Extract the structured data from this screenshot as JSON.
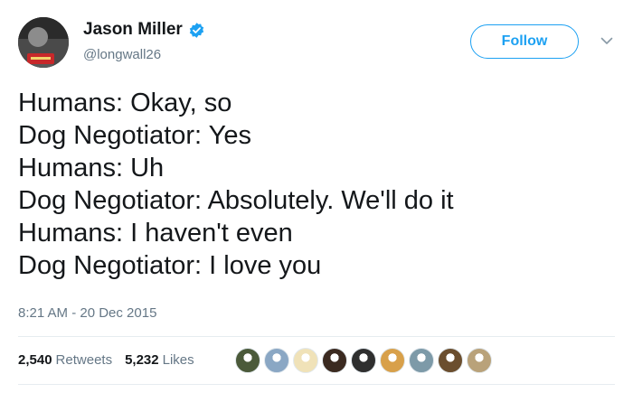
{
  "user": {
    "name": "Jason Miller",
    "handle": "@longwall26"
  },
  "follow_label": "Follow",
  "tweet_lines": [
    "Humans: Okay, so",
    "Dog Negotiator: Yes",
    "Humans: Uh",
    "Dog Negotiator: Absolutely. We'll do it",
    "Humans: I haven't even",
    "Dog Negotiator: I love you"
  ],
  "timestamp": "8:21 AM - 20 Dec 2015",
  "stats": {
    "retweets_count": "2,540",
    "retweets_label": "Retweets",
    "likes_count": "5,232",
    "likes_label": "Likes"
  },
  "colors": {
    "accent": "#1da1f2",
    "secondary_text": "#657786"
  },
  "liker_avatar_colors": [
    "#4b5a3a",
    "#8aa7c4",
    "#f0e2b8",
    "#3b2a20",
    "#2f2f2f",
    "#d8a04a",
    "#7d9aa8",
    "#6b4e2e",
    "#b9a27a"
  ]
}
